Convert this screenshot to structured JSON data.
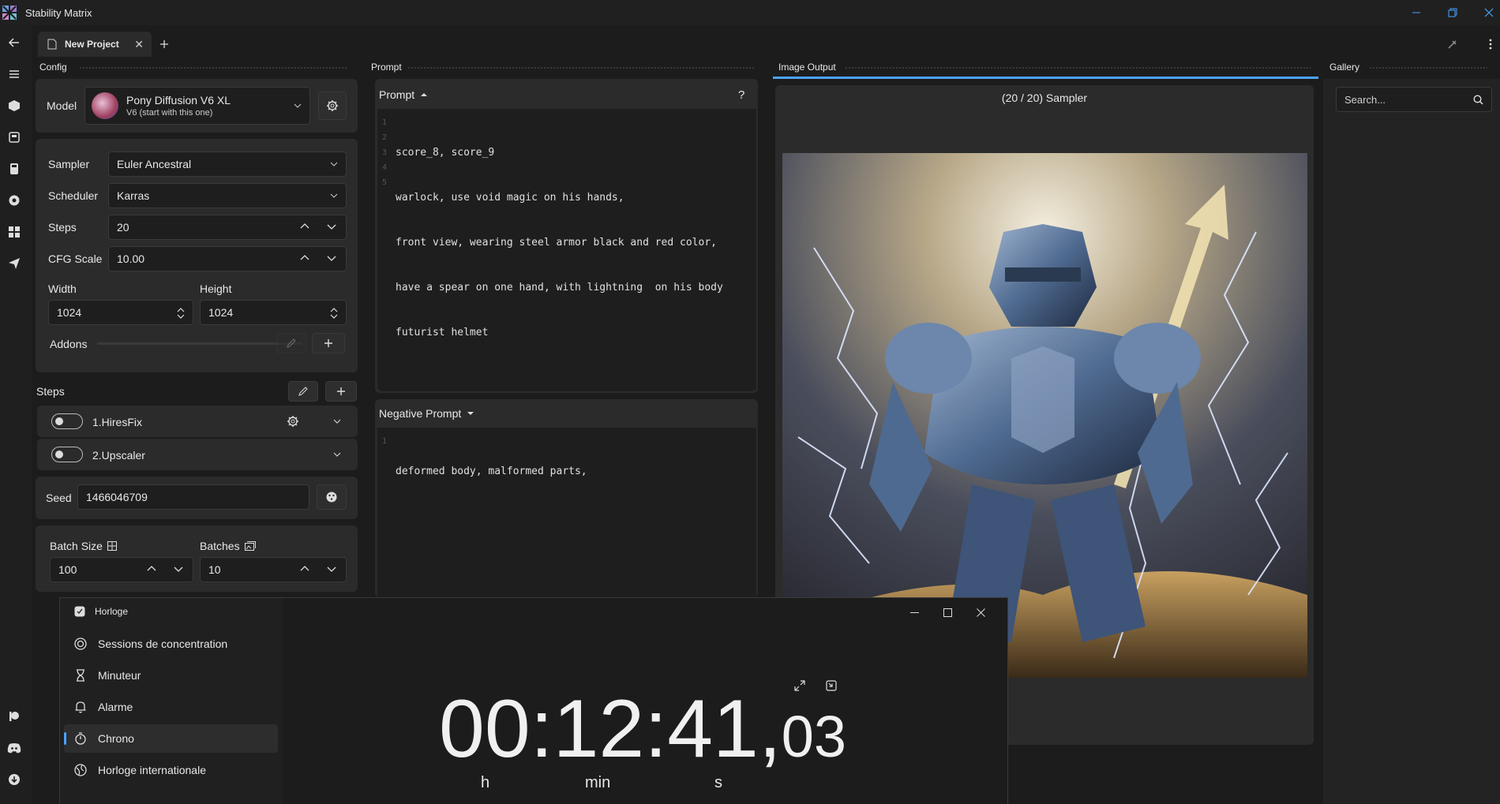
{
  "app": {
    "title": "Stability Matrix"
  },
  "tabs": [
    {
      "label": "New Project"
    }
  ],
  "panels": {
    "config": "Config",
    "prompt": "Prompt",
    "output": "Image Output",
    "gallery": "Gallery"
  },
  "config": {
    "model": {
      "label": "Model",
      "name": "Pony Diffusion V6 XL",
      "version": "V6 (start with this one)"
    },
    "sampler": {
      "label": "Sampler",
      "value": "Euler Ancestral"
    },
    "scheduler": {
      "label": "Scheduler",
      "value": "Karras"
    },
    "steps": {
      "label": "Steps",
      "value": "20"
    },
    "cfg": {
      "label": "CFG Scale",
      "value": "10.00"
    },
    "width": {
      "label": "Width",
      "value": "1024"
    },
    "height": {
      "label": "Height",
      "value": "1024"
    },
    "addons": {
      "label": "Addons"
    },
    "steps_section": {
      "label": "Steps",
      "items": [
        {
          "label": "1.HiresFix"
        },
        {
          "label": "2.Upscaler"
        }
      ]
    },
    "seed": {
      "label": "Seed",
      "value": "1466046709"
    },
    "batch_size": {
      "label": "Batch Size",
      "value": "100"
    },
    "batches": {
      "label": "Batches",
      "value": "10"
    }
  },
  "prompt": {
    "header": "Prompt",
    "help": "?",
    "lines": [
      "score_8, score_9",
      "warlock, use void magic on his hands,",
      "front view, wearing steel armor black and red color,",
      "have a spear on one hand, with lightning  on his body",
      "futurist helmet"
    ],
    "negative_header": "Negative Prompt",
    "negative_lines": [
      "deformed body, malformed parts,"
    ]
  },
  "output": {
    "progress": "(20 / 20) Sampler",
    "progress_fraction": 1.0
  },
  "gallery": {
    "search_placeholder": "Search..."
  },
  "clock_app": {
    "title": "Horloge",
    "nav": [
      {
        "label": "Sessions de concentration",
        "icon": "focus-icon"
      },
      {
        "label": "Minuteur",
        "icon": "hourglass-icon"
      },
      {
        "label": "Alarme",
        "icon": "bell-icon"
      },
      {
        "label": "Chrono",
        "icon": "stopwatch-icon",
        "active": true
      },
      {
        "label": "Horloge internationale",
        "icon": "globe-icon"
      }
    ],
    "time": {
      "hh": "00",
      "mm": "12",
      "ss": "41",
      "sep": ":",
      "comma": ",",
      "cs": "03"
    },
    "units": {
      "h": "h",
      "min": "min",
      "s": "s"
    }
  },
  "colors": {
    "accent": "#4aa3ff",
    "bg": "#1c1c1c",
    "card": "#2b2b2b"
  }
}
